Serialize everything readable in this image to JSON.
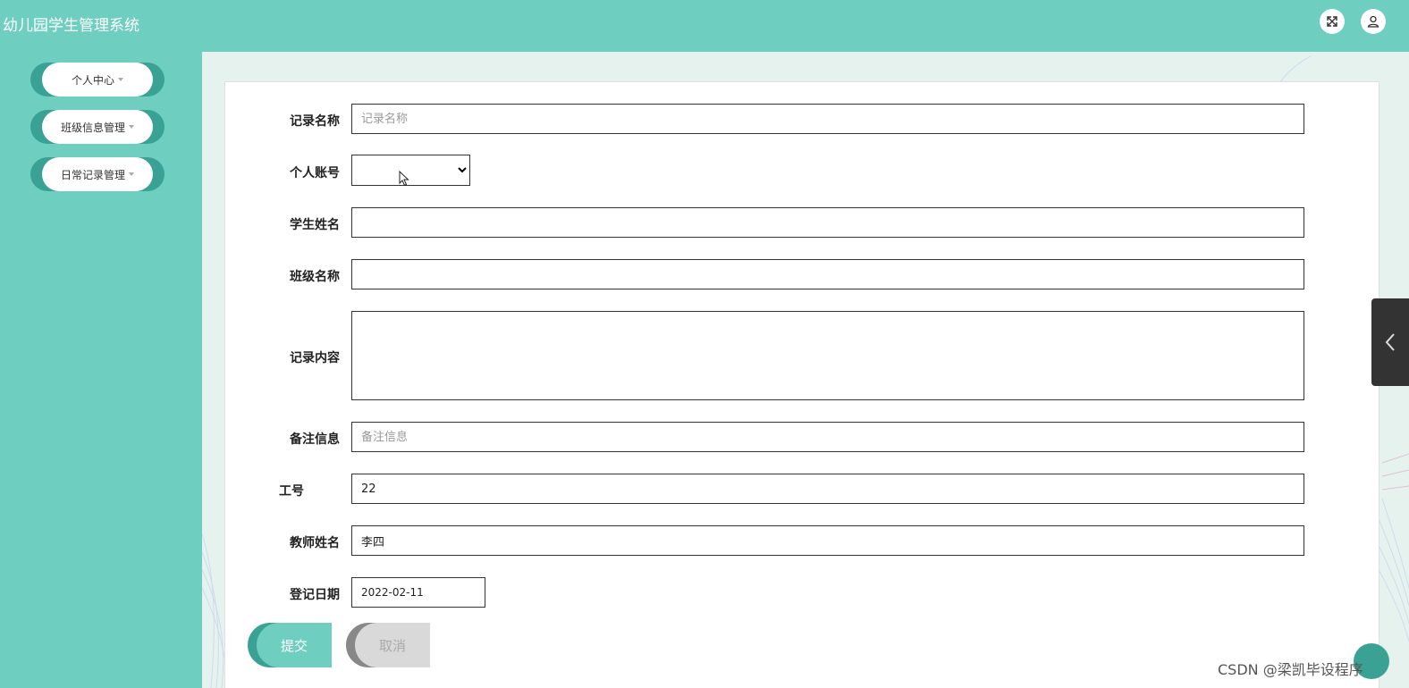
{
  "app": {
    "title": "幼儿园学生管理系统"
  },
  "header": {
    "fullscreen_icon": "fullscreen-icon",
    "user_icon": "user-icon"
  },
  "sidebar": {
    "items": [
      {
        "label": "个人中心"
      },
      {
        "label": "班级信息管理"
      },
      {
        "label": "日常记录管理"
      }
    ]
  },
  "form": {
    "record_name": {
      "label": "记录名称",
      "placeholder": "记录名称",
      "value": ""
    },
    "account": {
      "label": "个人账号",
      "value": ""
    },
    "student_name": {
      "label": "学生姓名",
      "value": ""
    },
    "class_name": {
      "label": "班级名称",
      "value": ""
    },
    "record_content": {
      "label": "记录内容",
      "value": ""
    },
    "remark": {
      "label": "备注信息",
      "placeholder": "备注信息",
      "value": ""
    },
    "job_no": {
      "label": "工号",
      "value": "22"
    },
    "teacher_name": {
      "label": "教师姓名",
      "value": "李四"
    },
    "register_date": {
      "label": "登记日期",
      "value": "2022-02-11"
    },
    "submit_label": "提交",
    "cancel_label": "取消"
  },
  "watermark": "CSDN @梁凯毕设程序",
  "colors": {
    "primary": "#6ecfc0",
    "primary_dark": "#3aa294",
    "content_bg": "#e6f2ee"
  }
}
